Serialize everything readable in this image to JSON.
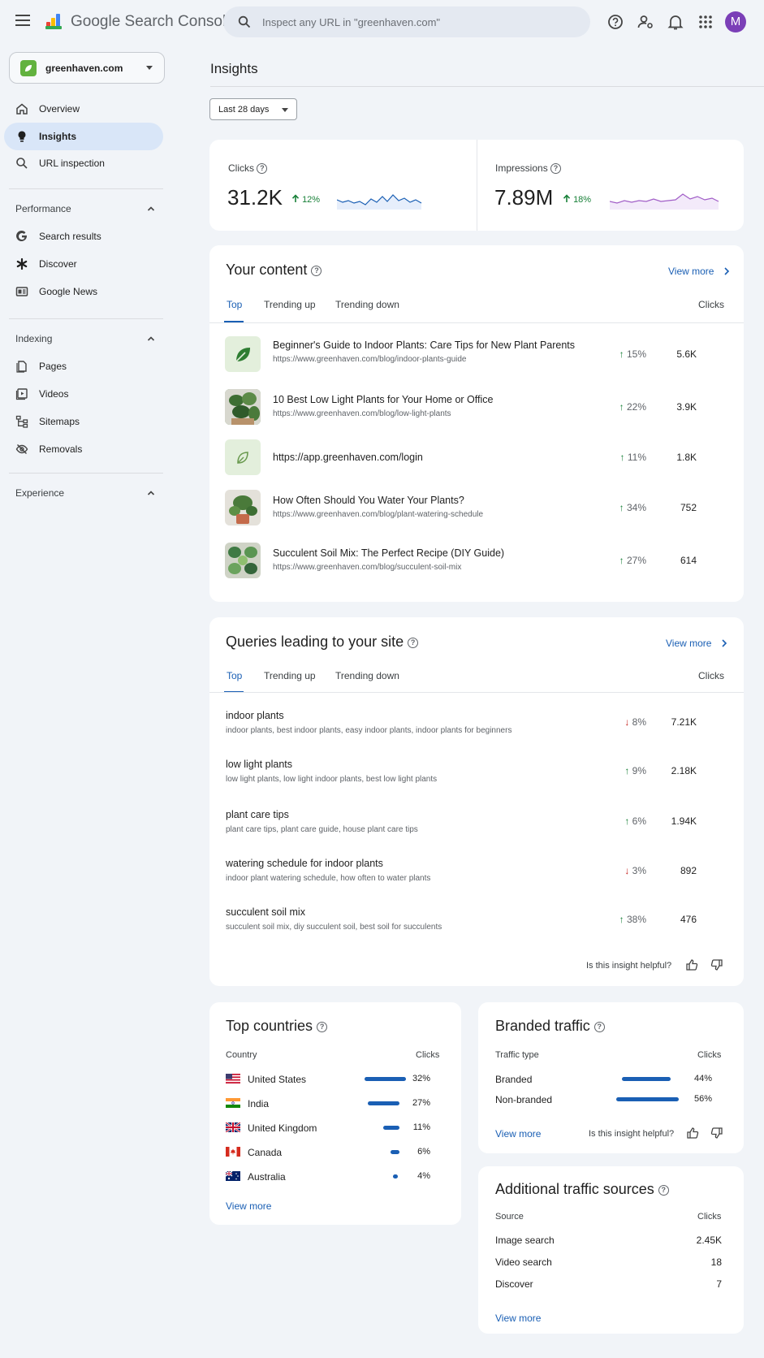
{
  "header": {
    "brand": "Google Search Console",
    "search_placeholder": "Inspect any URL in \"greenhaven.com\"",
    "avatar_initial": "M",
    "avatar_color": "#7b3fb7"
  },
  "sidebar": {
    "property": "greenhaven.com",
    "items_top": [
      {
        "label": "Overview",
        "icon": "home-icon"
      },
      {
        "label": "Insights",
        "icon": "lightbulb-icon",
        "active": true
      },
      {
        "label": "URL inspection",
        "icon": "search-icon"
      }
    ],
    "performance": {
      "heading": "Performance",
      "items": [
        {
          "label": "Search results",
          "icon": "google-g-icon"
        },
        {
          "label": "Discover",
          "icon": "asterisk-icon"
        },
        {
          "label": "Google News",
          "icon": "news-icon"
        }
      ]
    },
    "indexing": {
      "heading": "Indexing",
      "items": [
        {
          "label": "Pages",
          "icon": "pages-icon"
        },
        {
          "label": "Videos",
          "icon": "video-icon"
        },
        {
          "label": "Sitemaps",
          "icon": "sitemap-icon"
        },
        {
          "label": "Removals",
          "icon": "eye-off-icon"
        }
      ]
    },
    "experience": {
      "heading": "Experience"
    }
  },
  "main": {
    "title": "Insights",
    "date_range": "Last 28 days",
    "metrics": {
      "clicks": {
        "label": "Clicks",
        "value": "31.2K",
        "change": "12%"
      },
      "impressions": {
        "label": "Impressions",
        "value": "7.89M",
        "change": "18%"
      }
    },
    "content": {
      "title": "Your content",
      "view_more": "View more",
      "tabs": [
        "Top",
        "Trending up",
        "Trending down"
      ],
      "column": "Clicks",
      "rows": [
        {
          "title": "Beginner's Guide to Indoor Plants: Care Tips for New Plant Parents",
          "url": "https://www.greenhaven.com/blog/indoor-plants-guide",
          "change": "15%",
          "dir": "up",
          "value": "5.6K"
        },
        {
          "title": "10 Best Low Light Plants for Your Home or Office",
          "url": "https://www.greenhaven.com/blog/low-light-plants",
          "change": "22%",
          "dir": "up",
          "value": "3.9K"
        },
        {
          "title": "https://app.greenhaven.com/login",
          "url": "",
          "change": "11%",
          "dir": "up",
          "value": "1.8K"
        },
        {
          "title": "How Often Should You Water Your Plants?",
          "url": "https://www.greenhaven.com/blog/plant-watering-schedule",
          "change": "34%",
          "dir": "up",
          "value": "752"
        },
        {
          "title": "Succulent Soil Mix: The Perfect Recipe (DIY Guide)",
          "url": "https://www.greenhaven.com/blog/succulent-soil-mix",
          "change": "27%",
          "dir": "up",
          "value": "614"
        }
      ]
    },
    "queries": {
      "title": "Queries leading to your site",
      "view_more": "View more",
      "tabs": [
        "Top",
        "Trending up",
        "Trending down"
      ],
      "column": "Clicks",
      "rows": [
        {
          "title": "indoor plants",
          "sub": "indoor plants, best indoor plants, easy indoor plants, indoor plants for beginners",
          "change": "8%",
          "dir": "down",
          "value": "7.21K"
        },
        {
          "title": "low light plants",
          "sub": "low light plants, low light indoor plants, best low light plants",
          "change": "9%",
          "dir": "up",
          "value": "2.18K"
        },
        {
          "title": "plant care tips",
          "sub": "plant care tips, plant care guide, house plant care tips",
          "change": "6%",
          "dir": "up",
          "value": "1.94K"
        },
        {
          "title": "watering schedule for indoor plants",
          "sub": "indoor plant watering schedule, how often to water plants",
          "change": "3%",
          "dir": "down",
          "value": "892"
        },
        {
          "title": "succulent soil mix",
          "sub": "succulent soil mix, diy succulent soil, best soil for succulents",
          "change": "38%",
          "dir": "up",
          "value": "476"
        }
      ],
      "helpful": "Is this insight helpful?"
    },
    "countries": {
      "title": "Top countries",
      "col_left": "Country",
      "col_right": "Clicks",
      "rows": [
        {
          "name": "United States",
          "pct": "32%",
          "share": 0.32
        },
        {
          "name": "India",
          "pct": "27%",
          "share": 0.27
        },
        {
          "name": "United Kingdom",
          "pct": "11%",
          "share": 0.11
        },
        {
          "name": "Canada",
          "pct": "6%",
          "share": 0.06
        },
        {
          "name": "Australia",
          "pct": "4%",
          "share": 0.04
        }
      ],
      "view_more": "View more"
    },
    "branded": {
      "title": "Branded traffic",
      "col_left": "Traffic type",
      "col_right": "Clicks",
      "rows": [
        {
          "name": "Branded",
          "pct": "44%",
          "share": 0.44
        },
        {
          "name": "Non-branded",
          "pct": "56%",
          "share": 0.56
        }
      ],
      "view_more": "View more",
      "helpful": "Is this insight helpful?"
    },
    "additional": {
      "title": "Additional traffic sources",
      "col_left": "Source",
      "col_right": "Clicks",
      "rows": [
        {
          "name": "Image search",
          "value": "2.45K"
        },
        {
          "name": "Video search",
          "value": "18"
        },
        {
          "name": "Discover",
          "value": "7"
        }
      ],
      "view_more": "View more"
    }
  },
  "colors": {
    "accent": "#1a5fb4",
    "up": "#188038",
    "down": "#c5221f"
  }
}
